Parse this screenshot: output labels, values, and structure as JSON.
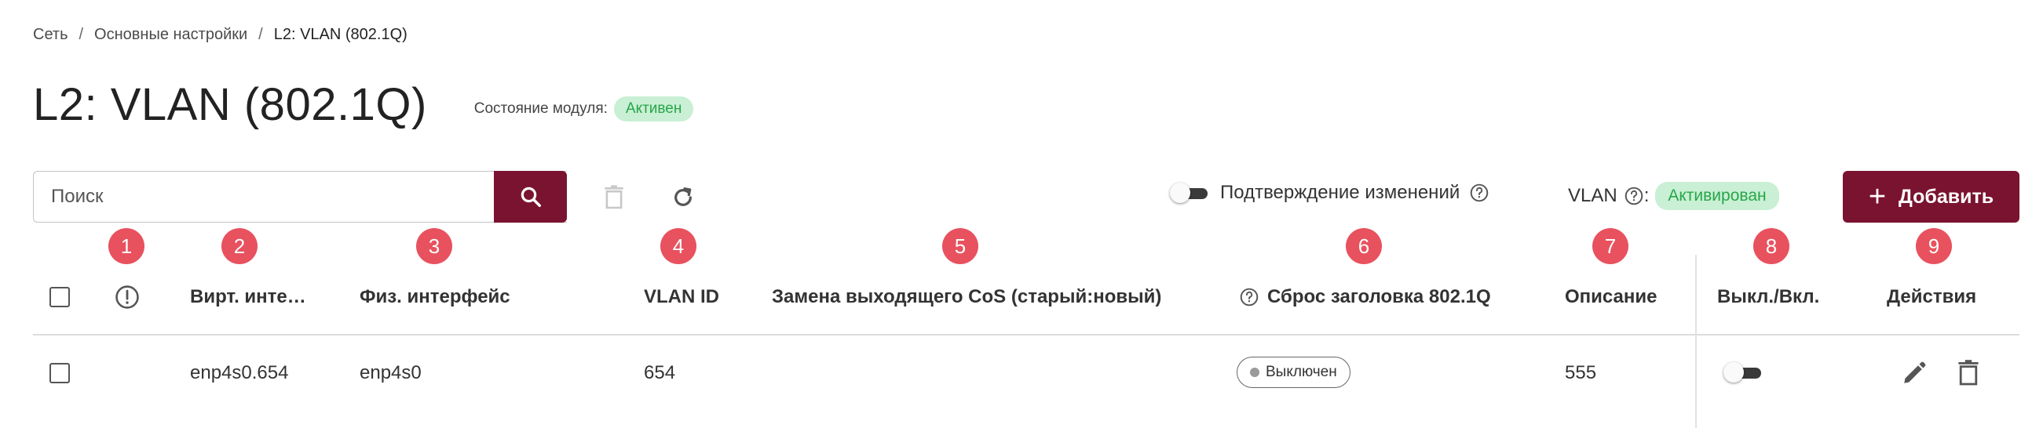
{
  "breadcrumb": {
    "items": [
      "Сеть",
      "Основные настройки",
      "L2: VLAN (802.1Q)"
    ],
    "separator": "/"
  },
  "page": {
    "title": "L2: VLAN (802.1Q)",
    "module_state_label": "Состояние модуля:",
    "module_state_value": "Активен"
  },
  "toolbar": {
    "search_placeholder": "Поиск",
    "confirm_label": "Подтверждение изменений",
    "confirm_enabled": false,
    "vlan_label": "VLAN",
    "vlan_colon": ":",
    "vlan_status": "Активирован",
    "add_label": "Добавить",
    "add_plus": "+"
  },
  "markers": [
    "1",
    "2",
    "3",
    "4",
    "5",
    "6",
    "7",
    "8",
    "9"
  ],
  "table": {
    "columns": {
      "virt": "Вирт. инте…",
      "phys": "Физ. интерфейс",
      "vlan_id": "VLAN ID",
      "cos": "Замена выходящего CoS (старый:новый)",
      "reset": "Сброс заголовка 802.1Q",
      "desc": "Описание",
      "onoff": "Выкл./Вкл.",
      "actions": "Действия"
    },
    "rows": [
      {
        "virt": "enp4s0.654",
        "phys": "enp4s0",
        "vlan_id": "654",
        "cos": "",
        "reset": "Выключен",
        "desc": "555",
        "enabled": false
      }
    ]
  },
  "colors": {
    "brand": "#7a1330",
    "marker": "#e8515e",
    "badge_bg": "#c9efd4",
    "badge_text": "#27a64a"
  },
  "icons": [
    "search-icon",
    "delete-icon",
    "refresh-icon",
    "help-icon",
    "warning-circle-icon",
    "edit-icon",
    "trash-icon"
  ]
}
